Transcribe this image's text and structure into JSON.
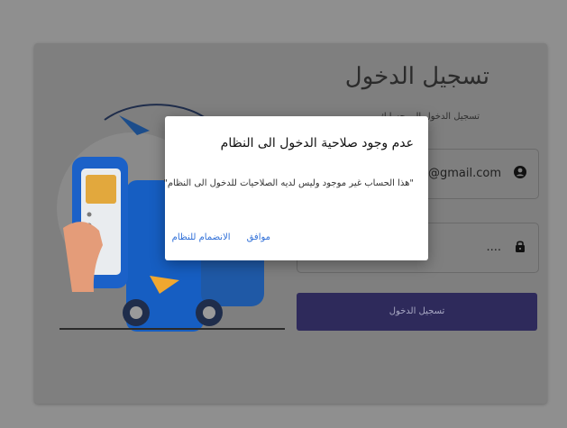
{
  "login": {
    "title": "تسجيل الدخول",
    "subtitle": "تسجيل الدخول إلى حسابك",
    "email_value": "aa@gmail.com",
    "password_value": "....",
    "submit_label": "تسجيل الدخول"
  },
  "dialog": {
    "title": "عدم وجود صلاحية الدخول الى النظام",
    "message": "\"هذا الحساب غير موجود وليس لديه الصلاحيات للدخول الى النظام\"",
    "confirm_label": "موافق",
    "join_label": "الانضمام للنظام"
  },
  "colors": {
    "overlay": "#8f8f8f",
    "card": "#7f7f7f",
    "button": "#2e2a5b",
    "dialog_action": "#2f6fd8"
  },
  "icons": {
    "email_icon": "account-circle-icon",
    "password_icon": "lock-icon"
  }
}
